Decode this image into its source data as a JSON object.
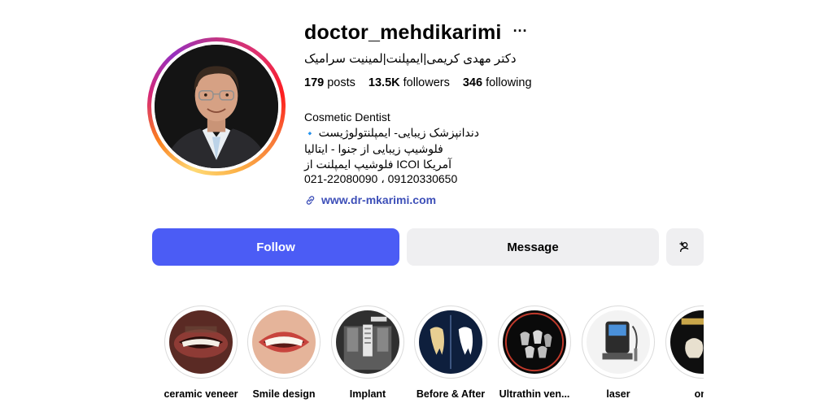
{
  "profile": {
    "username": "doctor_mehdikarimi",
    "more_icon": "more-horizontal-icon",
    "full_name": "دکتر مهدی کریمی|ایمپلنت|لمینیت سرامیک",
    "stats": {
      "posts_count": "179",
      "posts_label": "posts",
      "followers_count": "13.5K",
      "followers_label": "followers",
      "following_count": "346",
      "following_label": "following"
    },
    "bio": {
      "line1": "Cosmetic Dentist",
      "line2_icon": "🔹",
      "line2": "دندانپزشک زیبایی- ایمپلنتولوژیست",
      "line3": "فلوشیپ زیبایی از جنوا - ایتالیا",
      "line4": "فلوشیپ ایمپلنت از ICOI آمریکا",
      "line5": "021-22080090 ، 09120330650"
    },
    "website": "www.dr-mkarimi.com",
    "link_icon": "link-icon"
  },
  "actions": {
    "follow_label": "Follow",
    "message_label": "Message",
    "suggest_icon": "add-person-icon"
  },
  "colors": {
    "follow_bg": "#4b5cf5",
    "secondary_bg": "#efeff1",
    "link": "#3d4fb8"
  },
  "highlights": [
    {
      "label": "ceramic veneer"
    },
    {
      "label": "Smile design"
    },
    {
      "label": "Implant"
    },
    {
      "label": "Before & After"
    },
    {
      "label": "Ultrathin ven..."
    },
    {
      "label": "laser"
    },
    {
      "label": "onl"
    }
  ]
}
